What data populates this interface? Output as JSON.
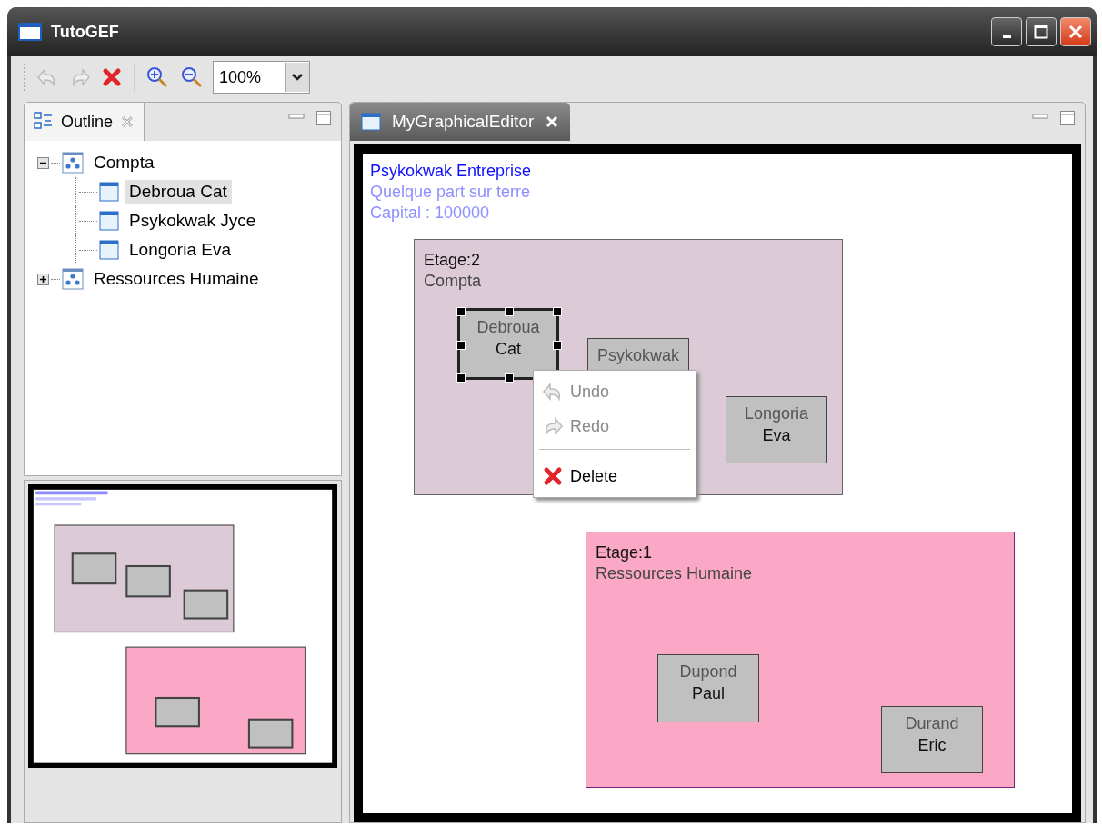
{
  "window": {
    "title": "TutoGEF"
  },
  "toolbar": {
    "zoom": "100%"
  },
  "outline": {
    "tab": "Outline",
    "tree": [
      {
        "label": "Compta",
        "kind": "floor",
        "expanded": true,
        "selected": false,
        "children": [
          {
            "label": "Debroua Cat",
            "kind": "employee",
            "selected": true
          },
          {
            "label": "Psykokwak Jyce",
            "kind": "employee",
            "selected": false
          },
          {
            "label": "Longoria Eva",
            "kind": "employee",
            "selected": false
          }
        ]
      },
      {
        "label": "Ressources Humaine",
        "kind": "floor",
        "expanded": false,
        "selected": false
      }
    ]
  },
  "editor": {
    "tab": "MyGraphicalEditor"
  },
  "diagram": {
    "company": {
      "name": "Psykokwak Entreprise",
      "address": "Quelque part sur terre",
      "capital": "Capital : 100000"
    },
    "floors": [
      {
        "label": "Etage:2",
        "name": "Compta",
        "color": "#dccbd6",
        "employees": [
          {
            "first": "Debroua",
            "last": "Cat",
            "selected": true
          },
          {
            "first": "Psykokwak",
            "selected": false
          },
          {
            "first": "Longoria",
            "last": "Eva",
            "selected": false
          }
        ]
      },
      {
        "label": "Etage:1",
        "name": "Ressources Humaine",
        "color": "#fba8c6",
        "employees": [
          {
            "first": "Dupond",
            "last": "Paul",
            "selected": false
          },
          {
            "first": "Durand",
            "last": "Eric",
            "selected": false
          }
        ]
      }
    ]
  },
  "context_menu": [
    {
      "label": "Undo",
      "kind": "undo",
      "disabled": true
    },
    {
      "label": "Redo",
      "kind": "redo",
      "disabled": true
    },
    {
      "label": "Delete",
      "kind": "delete",
      "disabled": false
    }
  ]
}
